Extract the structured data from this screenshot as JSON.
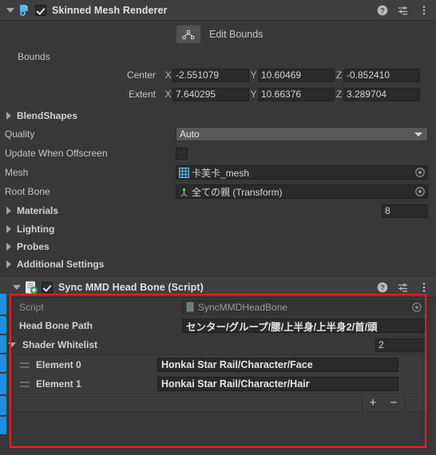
{
  "components": [
    {
      "id": "skinned-mesh-renderer",
      "title": "Skinned Mesh Renderer",
      "enabled": true,
      "expanded": true,
      "icon": "skinned-mesh-renderer-icon",
      "header_icons": [
        "help-icon",
        "preset-icon",
        "more-menu-icon"
      ],
      "edit_bounds": {
        "label": "Edit Bounds",
        "icon": "edit-bounds-icon"
      },
      "bounds": {
        "label": "Bounds",
        "center": {
          "label": "Center",
          "x_axis": "X",
          "x": "-2.551079",
          "y_axis": "Y",
          "y": "10.60469",
          "z_axis": "Z",
          "z": "-0.852410"
        },
        "extent": {
          "label": "Extent",
          "x_axis": "X",
          "x": "7.640295",
          "y_axis": "Y",
          "y": "10.66376",
          "z_axis": "Z",
          "z": "3.289704"
        }
      },
      "blendshapes": {
        "label": "BlendShapes",
        "expanded": false
      },
      "quality": {
        "label": "Quality",
        "value": "Auto",
        "options": [
          "Auto"
        ]
      },
      "update_when_offscreen": {
        "label": "Update When Offscreen",
        "checked": false
      },
      "mesh": {
        "label": "Mesh",
        "value": "卡芙卡_mesh",
        "icon": "mesh-asset-icon"
      },
      "root_bone": {
        "label": "Root Bone",
        "value": "全ての親 (Transform)",
        "icon": "transform-gizmo-icon"
      },
      "materials": {
        "label": "Materials",
        "expanded": false,
        "count": "8"
      },
      "lighting": {
        "label": "Lighting",
        "expanded": false
      },
      "probes": {
        "label": "Probes",
        "expanded": false
      },
      "additional_settings": {
        "label": "Additional Settings",
        "expanded": false
      }
    },
    {
      "id": "sync-mmd-head-bone",
      "title": "Sync MMD Head Bone (Script)",
      "enabled": true,
      "expanded": true,
      "icon": "cs-script-icon",
      "header_icons": [
        "help-icon",
        "preset-icon",
        "more-menu-icon"
      ],
      "script": {
        "label": "Script",
        "value": "SyncMMDHeadBone",
        "icon": "script-asset-icon"
      },
      "head_bone_path": {
        "label": "Head Bone Path",
        "value": "センター/グループ/腰/上半身/上半身2/首/頭"
      },
      "shader_whitelist": {
        "label": "Shader Whitelist",
        "expanded": true,
        "size": "2",
        "elements": [
          {
            "label": "Element 0",
            "value": "Honkai Star Rail/Character/Face"
          },
          {
            "label": "Element 1",
            "value": "Honkai Star Rail/Character/Hair"
          }
        ],
        "add_button": "+",
        "remove_button": "−"
      }
    }
  ],
  "colors": {
    "background": "#383838",
    "header_background": "#3f3f3f",
    "field_background": "#2a2a2a",
    "dropdown_background": "#585858",
    "highlight_box": "#ff1e1e",
    "prefab_override_strip": "#1d8fe0",
    "text": "#c4c4c4",
    "text_dim": "#8f8f8f"
  }
}
